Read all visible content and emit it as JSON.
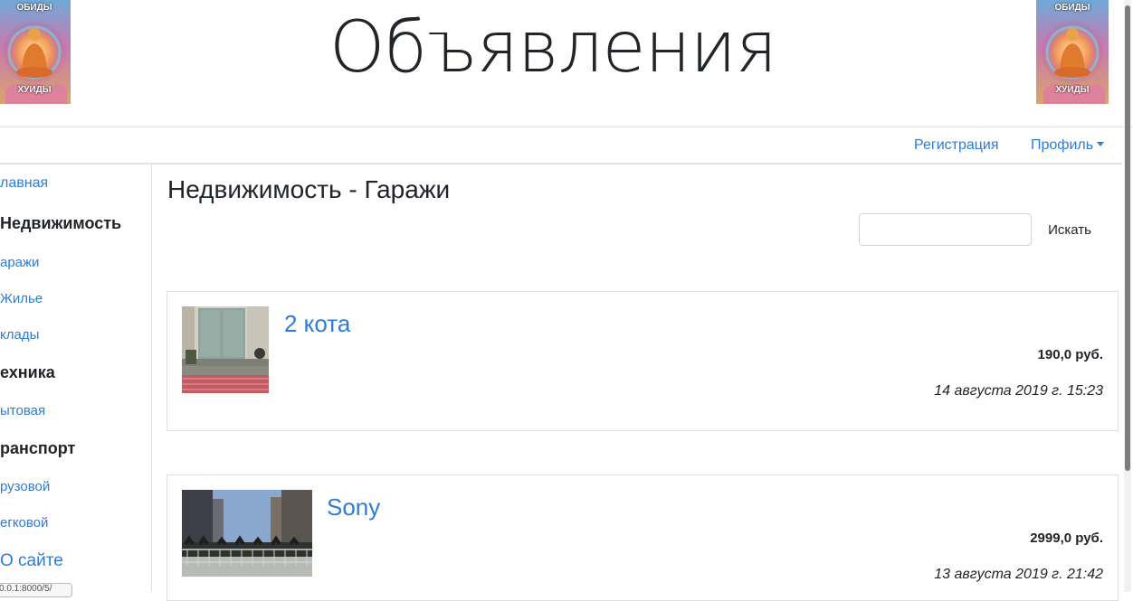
{
  "header": {
    "site_title": "Объявления",
    "logo_text_top": "ОБИДЫ",
    "logo_text_bottom": "ХУИДЫ"
  },
  "navbar": {
    "register_label": "Регистрация",
    "profile_label": "Профиль"
  },
  "sidebar": {
    "items": [
      {
        "label": "лавная"
      },
      {
        "label": "Недвижимость"
      },
      {
        "label": "аражи"
      },
      {
        "label": "Жилье"
      },
      {
        "label": "клады"
      },
      {
        "label": "ехника"
      },
      {
        "label": "ытовая"
      },
      {
        "label": "ранспорт"
      },
      {
        "label": "рузовой"
      },
      {
        "label": "егковой"
      },
      {
        "label": "О сайте"
      }
    ]
  },
  "status_url": "0.0.1:8000/5/",
  "main": {
    "page_title": "Недвижимость - Гаражи",
    "search": {
      "placeholder": "",
      "button_label": "Искать"
    },
    "ads": [
      {
        "title": "2 кота",
        "price": "190,0 руб.",
        "date": "14 августа 2019 г. 15:23"
      },
      {
        "title": "Sony",
        "price": "2999,0 руб.",
        "date": "13 августа 2019 г. 21:42"
      }
    ]
  },
  "colors": {
    "link": "#2f7bd8",
    "text": "#212529",
    "border": "#dee2e6"
  }
}
